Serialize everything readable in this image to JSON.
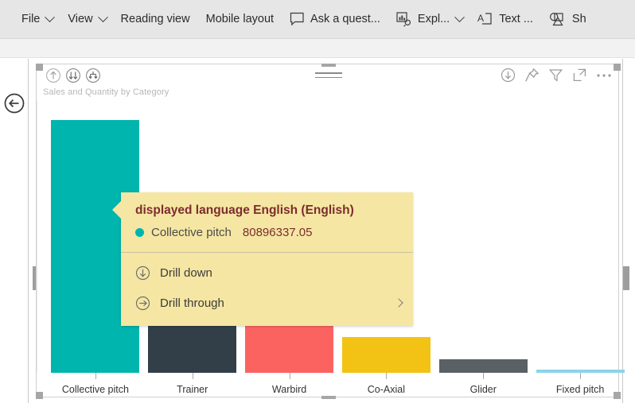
{
  "ribbon": {
    "items": [
      {
        "label": "File",
        "icon": null,
        "caret": true
      },
      {
        "label": "View",
        "icon": null,
        "caret": true
      },
      {
        "label": "Reading view",
        "icon": null,
        "caret": false
      },
      {
        "label": "Mobile layout",
        "icon": null,
        "caret": false
      },
      {
        "label": "Ask a quest...",
        "icon": "speech-bubble-icon",
        "caret": false
      },
      {
        "label": "Expl...",
        "icon": "explore-icon",
        "caret": true
      },
      {
        "label": "Text ...",
        "icon": "text-box-icon",
        "caret": false
      },
      {
        "label": "Sh",
        "icon": "shapes-icon",
        "caret": false
      }
    ]
  },
  "navigation": {
    "back_icon": "back-arrow-icon"
  },
  "visual": {
    "title": "Sales and Quantity by Category",
    "drill_icons": [
      {
        "name": "drill-up-icon"
      },
      {
        "name": "go-to-next-level-icon"
      },
      {
        "name": "expand-all-down-icon"
      }
    ],
    "drag_handle": "drag-handle-icon",
    "header_icons": [
      {
        "name": "export-data-icon"
      },
      {
        "name": "pin-visual-icon"
      },
      {
        "name": "filter-icon"
      },
      {
        "name": "focus-mode-icon"
      },
      {
        "name": "more-options-icon"
      }
    ]
  },
  "chart_data": {
    "type": "bar",
    "title": "Sales and Quantity by Category",
    "xlabel": "",
    "ylabel": "",
    "grid": false,
    "legend": false,
    "categories": [
      "Collective pitch",
      "Trainer",
      "Warbird",
      "Co-Axial",
      "Glider",
      "Fixed pitch"
    ],
    "values": [
      80896337.05,
      47000000,
      28000000,
      11500000,
      4200000,
      900000
    ],
    "value_labels": [
      "80896337.05",
      "",
      "",
      "",
      "",
      ""
    ],
    "colors": [
      "#00b5ad",
      "#333f48",
      "#fb6361",
      "#f2c314",
      "#5a6165",
      "#8ad4eb"
    ],
    "ylim": [
      0,
      85000000
    ],
    "highlighted_category": "Collective pitch"
  },
  "tooltip": {
    "title": "displayed language English (English)",
    "series_dot_color": "#00b5ad",
    "series_label": "Collective pitch",
    "series_value": "80896337.05",
    "menu": [
      {
        "label": "Drill down",
        "icon": "drill-down-icon",
        "submenu": false
      },
      {
        "label": "Drill through",
        "icon": "drill-through-icon",
        "submenu": true
      }
    ]
  }
}
